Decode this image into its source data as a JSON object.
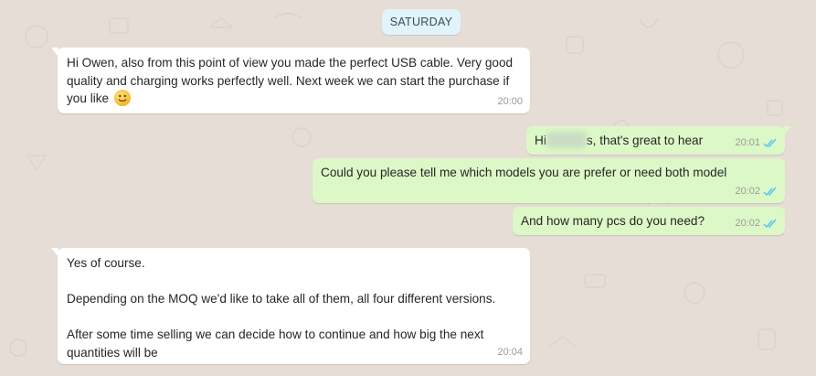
{
  "date_label": "SATURDAY",
  "colors": {
    "background": "#e6ded6",
    "incoming_bubble": "#ffffff",
    "outgoing_bubble": "#dcf8c6",
    "read_ticks": "#4fc3f7",
    "date_chip": "#e1f3fb"
  },
  "messages": [
    {
      "direction": "incoming",
      "text": "Hi Owen, also from this point of view you made the perfect USB cable. Very good quality and charging works perfectly well. Next week we can start the purchase if you like",
      "emoji": "slightly-smiling-face-icon",
      "time": "20:00"
    },
    {
      "direction": "outgoing",
      "text_before": "Hi",
      "text_after": "s, that's great to hear",
      "redacted": true,
      "time": "20:01",
      "status": "read"
    },
    {
      "direction": "outgoing",
      "text": "Could you please tell me which models you are prefer or need both model",
      "time": "20:02",
      "status": "read"
    },
    {
      "direction": "outgoing",
      "text": "And how many pcs do you need?",
      "time": "20:02",
      "status": "read"
    },
    {
      "direction": "incoming",
      "text": "Yes of course.\n\nDepending on the MOQ we'd like to take all of them, all four different versions.\n\nAfter some time selling we can decide how to continue and how big the next quantities will be",
      "time": "20:04"
    }
  ]
}
